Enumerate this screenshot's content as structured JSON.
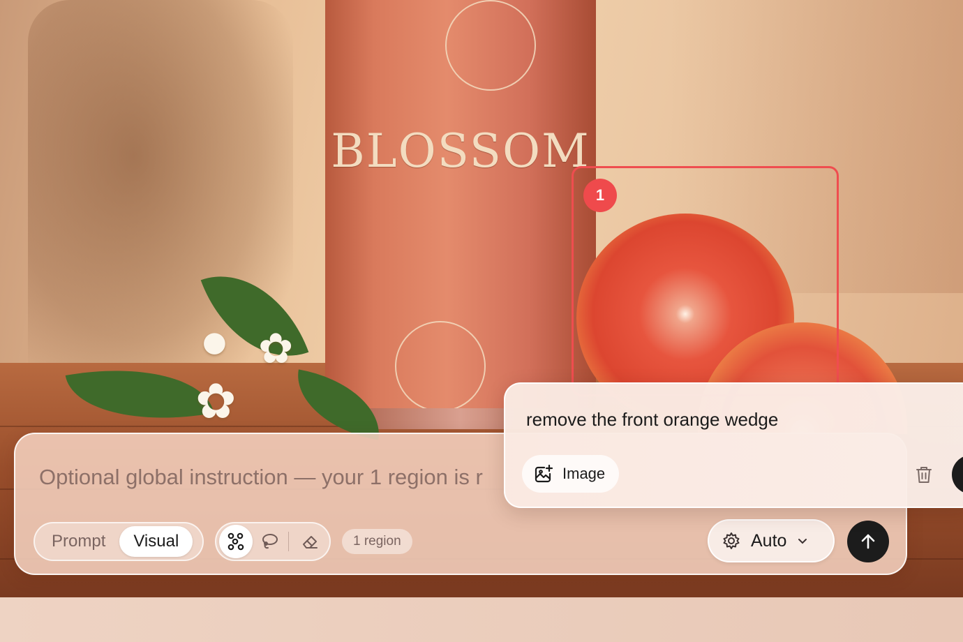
{
  "photo": {
    "can_brand": "BLOSSOM",
    "selected_region_number": "1"
  },
  "composer": {
    "global_instruction_placeholder": "Optional global instruction — your 1 region is r",
    "mode_prompt_label": "Prompt",
    "mode_visual_label": "Visual",
    "active_mode": "Visual",
    "tools": [
      "select-points-icon",
      "lasso-icon",
      "eraser-icon"
    ],
    "region_count_label": "1 region",
    "model_selector_label": "Auto",
    "send_icon": "arrow-up-icon"
  },
  "region_popover": {
    "prompt_text": "remove the front orange wedge",
    "image_button_label": "Image",
    "image_icon": "image-add-icon",
    "delete_icon": "trash-icon"
  },
  "colors": {
    "region_accent": "#ef4d4f",
    "send_button": "#1c1c1c"
  }
}
